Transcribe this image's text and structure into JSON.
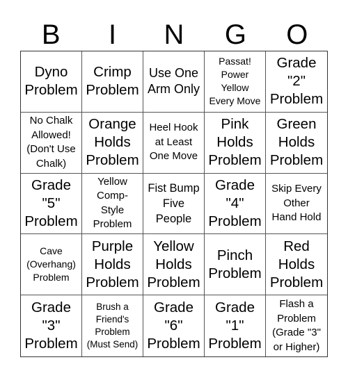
{
  "card": {
    "header": [
      "B",
      "I",
      "N",
      "G",
      "O"
    ],
    "cells": [
      {
        "text": "Dyno\nProblem",
        "size": "sz-xl"
      },
      {
        "text": "Crimp\nProblem",
        "size": "sz-xl"
      },
      {
        "text": "Use One\nArm Only",
        "size": "sz-l"
      },
      {
        "text": "Passat!\nPower\nYellow\nEvery Move",
        "size": "sz-xs"
      },
      {
        "text": "Grade\n\"2\"\nProblem",
        "size": "sz-xl"
      },
      {
        "text": "No Chalk\nAllowed!\n(Don't Use\nChalk)",
        "size": "sz-s"
      },
      {
        "text": "Orange\nHolds\nProblem",
        "size": "sz-xl"
      },
      {
        "text": "Heel Hook\nat Least\nOne Move",
        "size": "sz-s"
      },
      {
        "text": "Pink\nHolds\nProblem",
        "size": "sz-xl"
      },
      {
        "text": "Green\nHolds\nProblem",
        "size": "sz-xl"
      },
      {
        "text": "Grade\n\"5\"\nProblem",
        "size": "sz-xl"
      },
      {
        "text": "Yellow\nComp-\nStyle\nProblem",
        "size": "sz-s"
      },
      {
        "text": "Fist Bump\nFive\nPeople",
        "size": "sz-m"
      },
      {
        "text": "Grade\n\"4\"\nProblem",
        "size": "sz-xl"
      },
      {
        "text": "Skip Every\nOther\nHand Hold",
        "size": "sz-s"
      },
      {
        "text": "Cave\n(Overhang)\nProblem",
        "size": "sz-xs"
      },
      {
        "text": "Purple\nHolds\nProblem",
        "size": "sz-xl"
      },
      {
        "text": "Yellow\nHolds\nProblem",
        "size": "sz-xl"
      },
      {
        "text": "Pinch\nProblem",
        "size": "sz-xl"
      },
      {
        "text": "Red\nHolds\nProblem",
        "size": "sz-xl"
      },
      {
        "text": "Grade\n\"3\"\nProblem",
        "size": "sz-xl"
      },
      {
        "text": "Brush a\nFriend's\nProblem\n(Must Send)",
        "size": "sz-xxs"
      },
      {
        "text": "Grade\n\"6\"\nProblem",
        "size": "sz-xl"
      },
      {
        "text": "Grade\n\"1\"\nProblem",
        "size": "sz-xl"
      },
      {
        "text": "Flash a\nProblem\n(Grade \"3\"\nor Higher)",
        "size": "sz-s"
      }
    ]
  }
}
